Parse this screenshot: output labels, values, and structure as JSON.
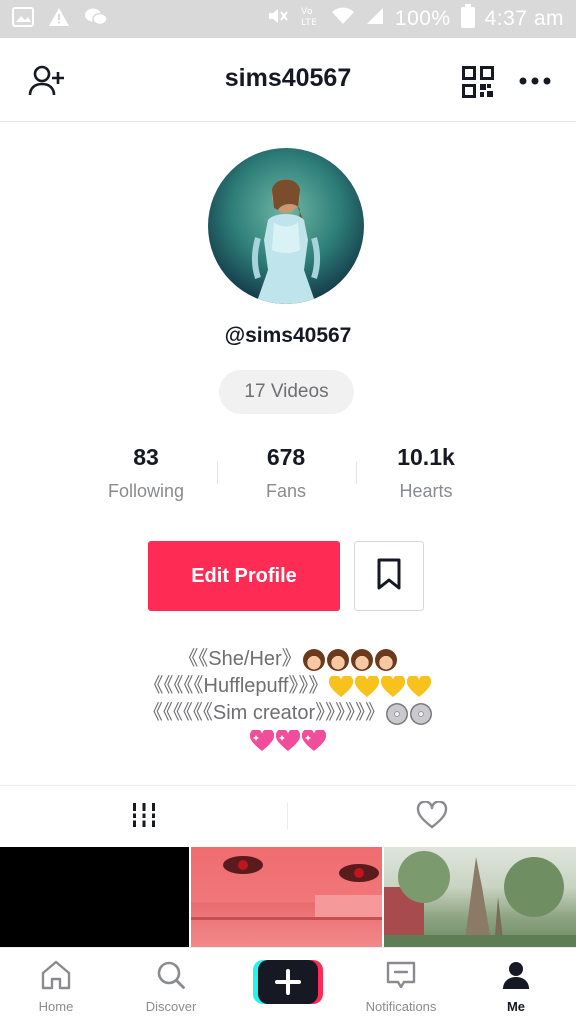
{
  "status_bar": {
    "battery": "100%",
    "time": "4:37 am",
    "icons": [
      "gallery-icon",
      "warning-icon",
      "chat-icon",
      "mute-icon",
      "volte-icon",
      "wifi-icon",
      "signal-icon",
      "battery-icon"
    ]
  },
  "header": {
    "title": "sims40567",
    "icons": [
      "add-user-icon",
      "qr-code-icon",
      "more-icon"
    ]
  },
  "profile": {
    "handle": "@sims40567",
    "videos_label": "17 Videos"
  },
  "stats": [
    {
      "value": "83",
      "label": "Following"
    },
    {
      "value": "678",
      "label": "Fans"
    },
    {
      "value": "10.1k",
      "label": "Hearts"
    }
  ],
  "actions": {
    "edit_profile_label": "Edit Profile",
    "bookmark_icon": "bookmark-icon"
  },
  "bio": {
    "line1": "《《She/Her》",
    "line2": "《《《《《Hufflepuff》》》",
    "line3": "《《《《《《Sim creator》》》》》》"
  },
  "tabs": [
    "grid-icon",
    "heart-outline-icon"
  ],
  "nav": {
    "home": "Home",
    "discover": "Discover",
    "notifications": "Notifications",
    "me": "Me"
  },
  "colors": {
    "accent": "#fe2c55",
    "status_bar_bg": "#d9d9d9",
    "text_primary": "#161823",
    "text_secondary": "#8a8b91",
    "heart_yellow": "#f7c21b",
    "heart_pink": "#f04d9b"
  }
}
